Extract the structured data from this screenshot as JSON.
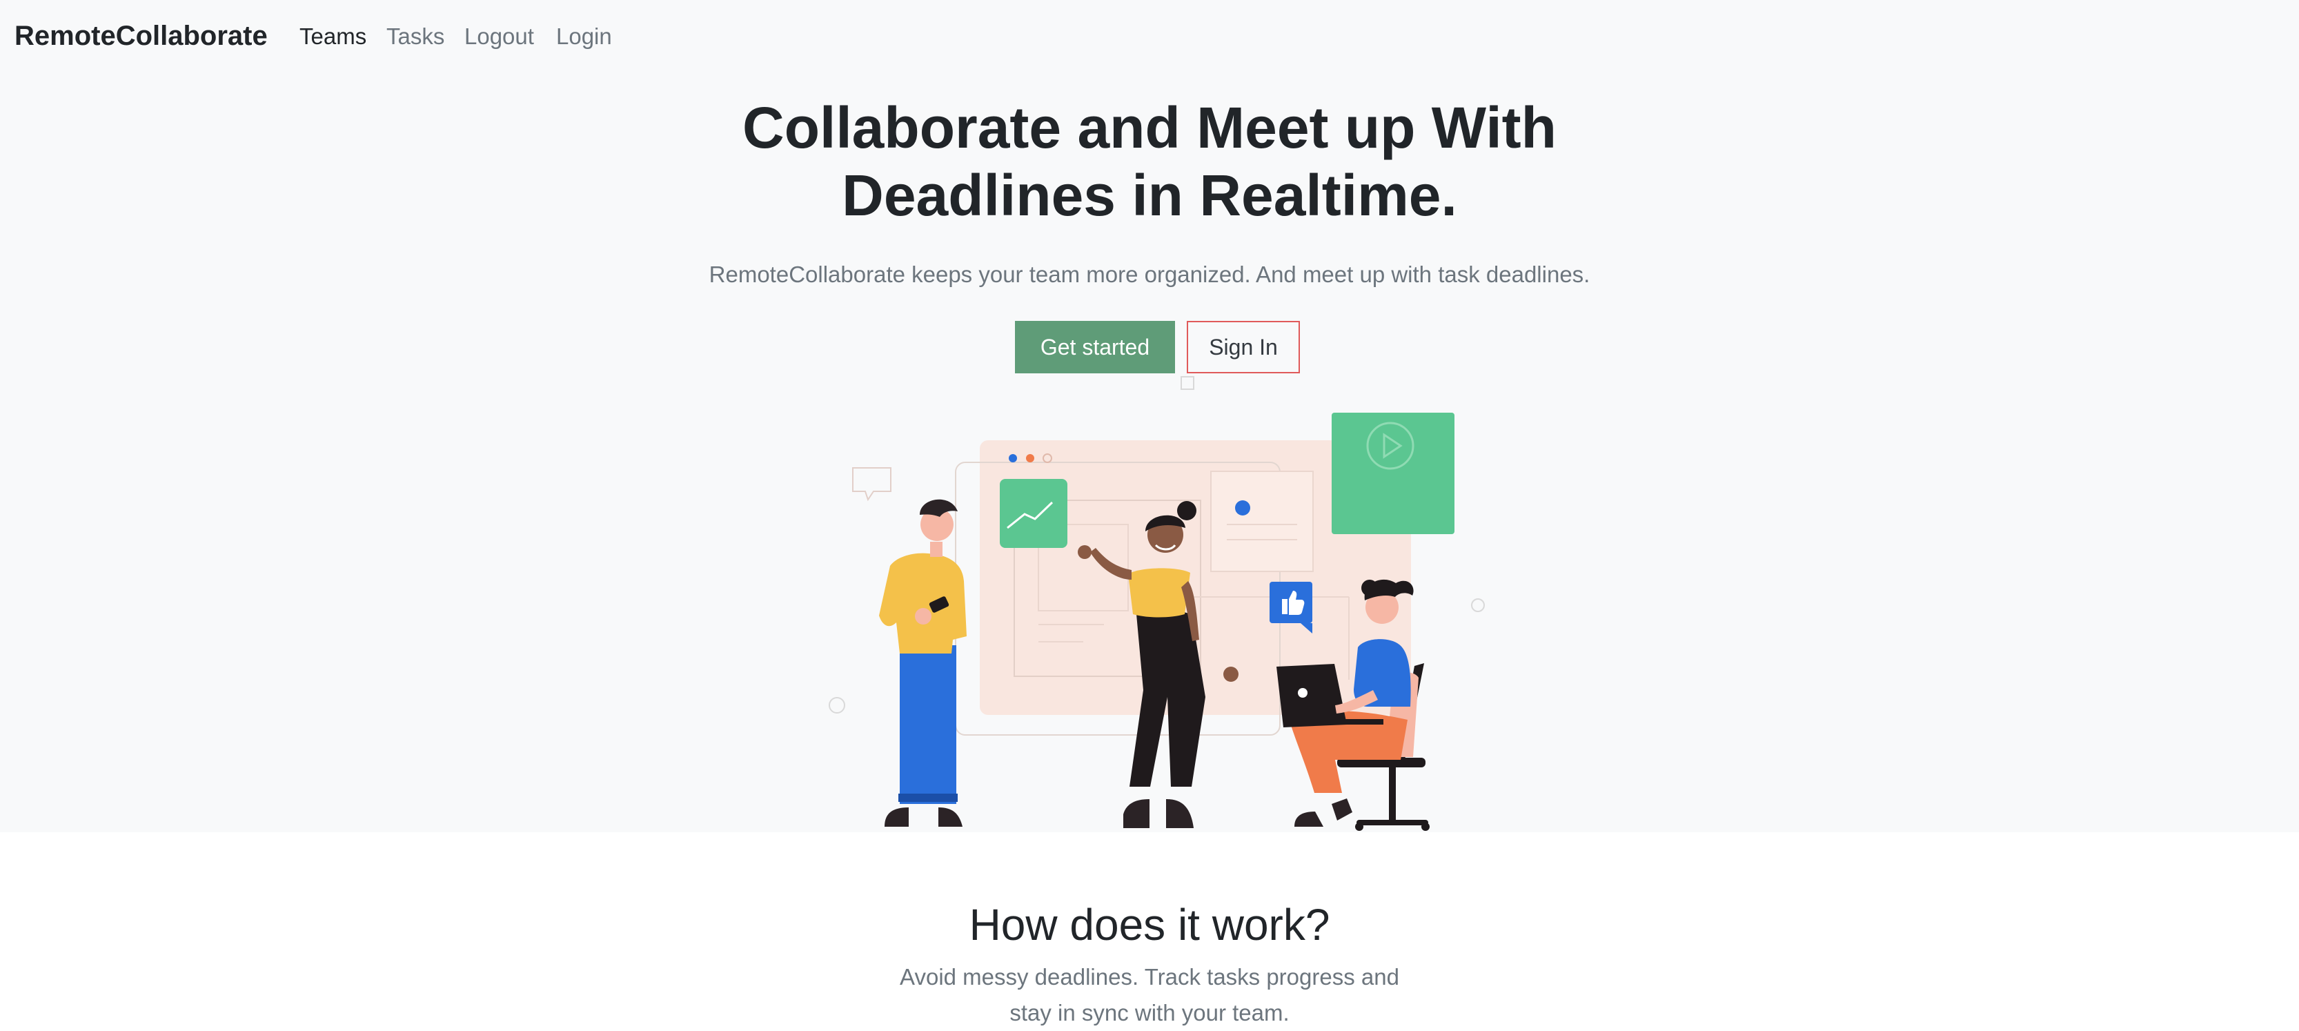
{
  "nav": {
    "brand": "RemoteCollaborate",
    "links": [
      "Teams",
      "Tasks",
      "Logout",
      "Login"
    ]
  },
  "hero": {
    "headline_line1": "Collaborate and Meet up With",
    "headline_line2": "Deadlines in Realtime.",
    "lead": "RemoteCollaborate keeps your team more organized. And meet up with task deadlines.",
    "primary_button": "Get started",
    "secondary_button": "Sign In",
    "illustration": "team-collaboration-illustration"
  },
  "how_it_works": {
    "title": "How does it work?",
    "subtitle": "Avoid messy deadlines. Track tasks progress and stay in sync with your team."
  },
  "colors": {
    "accent_green": "#5f9c78",
    "outline_red": "#e05a5a",
    "hero_bg": "#f8f9fa"
  }
}
